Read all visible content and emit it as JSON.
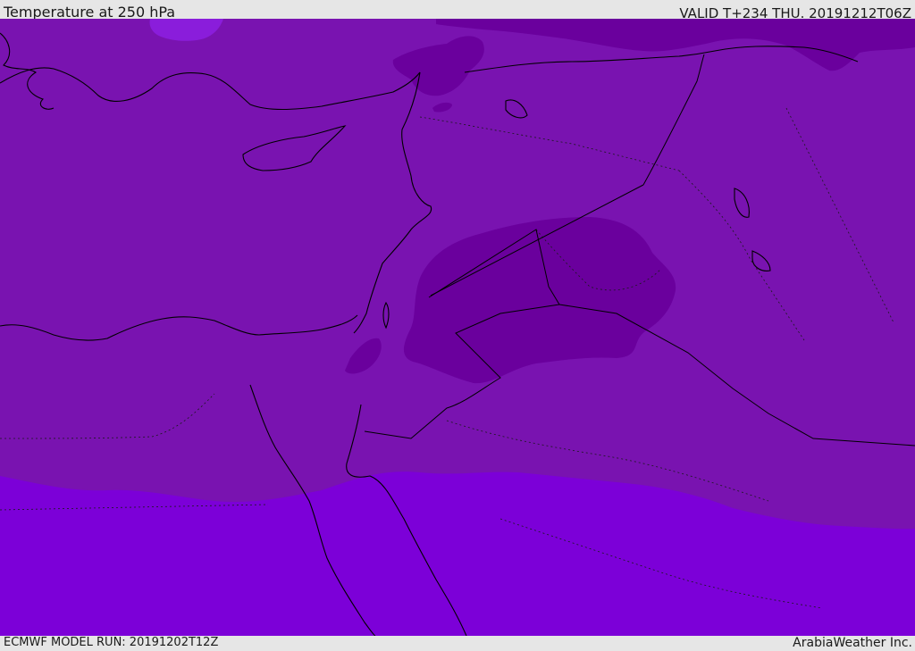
{
  "header": {
    "title": "Temperature at 250 hPa",
    "valid": "VALID T+234 THU. 20191212T06Z"
  },
  "footer": {
    "model_run": "ECMWF MODEL RUN: 20191202T12Z",
    "credit": "ArabiaWeather Inc."
  },
  "colors": {
    "frame_bg": "#e6e6e6",
    "band_cold": "#6a009d",
    "band_mid": "#7913b0",
    "band_warmer": "#7c00d8",
    "band_light": "#8a1ddb",
    "coastline": "#000000",
    "border": "#1a1a1a"
  }
}
